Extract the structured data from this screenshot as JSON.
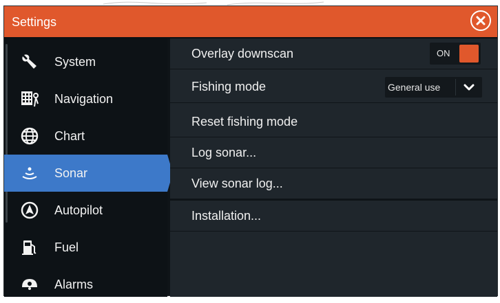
{
  "window": {
    "title": "Settings"
  },
  "sidebar": {
    "items": [
      {
        "label": "System",
        "icon": "wrench-icon"
      },
      {
        "label": "Navigation",
        "icon": "navigation-icon"
      },
      {
        "label": "Chart",
        "icon": "globe-icon"
      },
      {
        "label": "Sonar",
        "icon": "sonar-icon",
        "active": true
      },
      {
        "label": "Autopilot",
        "icon": "autopilot-icon"
      },
      {
        "label": "Fuel",
        "icon": "fuel-pump-icon"
      },
      {
        "label": "Alarms",
        "icon": "alarm-bell-icon"
      }
    ]
  },
  "main": {
    "overlay_downscan": {
      "label": "Overlay downscan",
      "toggle_value": "ON"
    },
    "fishing_mode": {
      "label": "Fishing mode",
      "selected": "General use"
    },
    "reset_fishing_mode": {
      "label": "Reset fishing mode"
    },
    "log_sonar": {
      "label": "Log sonar..."
    },
    "view_sonar_log": {
      "label": "View sonar log..."
    },
    "installation": {
      "label": "Installation..."
    }
  },
  "colors": {
    "titlebar": "#e0582c",
    "accent_active": "#3d79c9",
    "panel": "#1f262c",
    "sidebar": "#0d1216"
  }
}
